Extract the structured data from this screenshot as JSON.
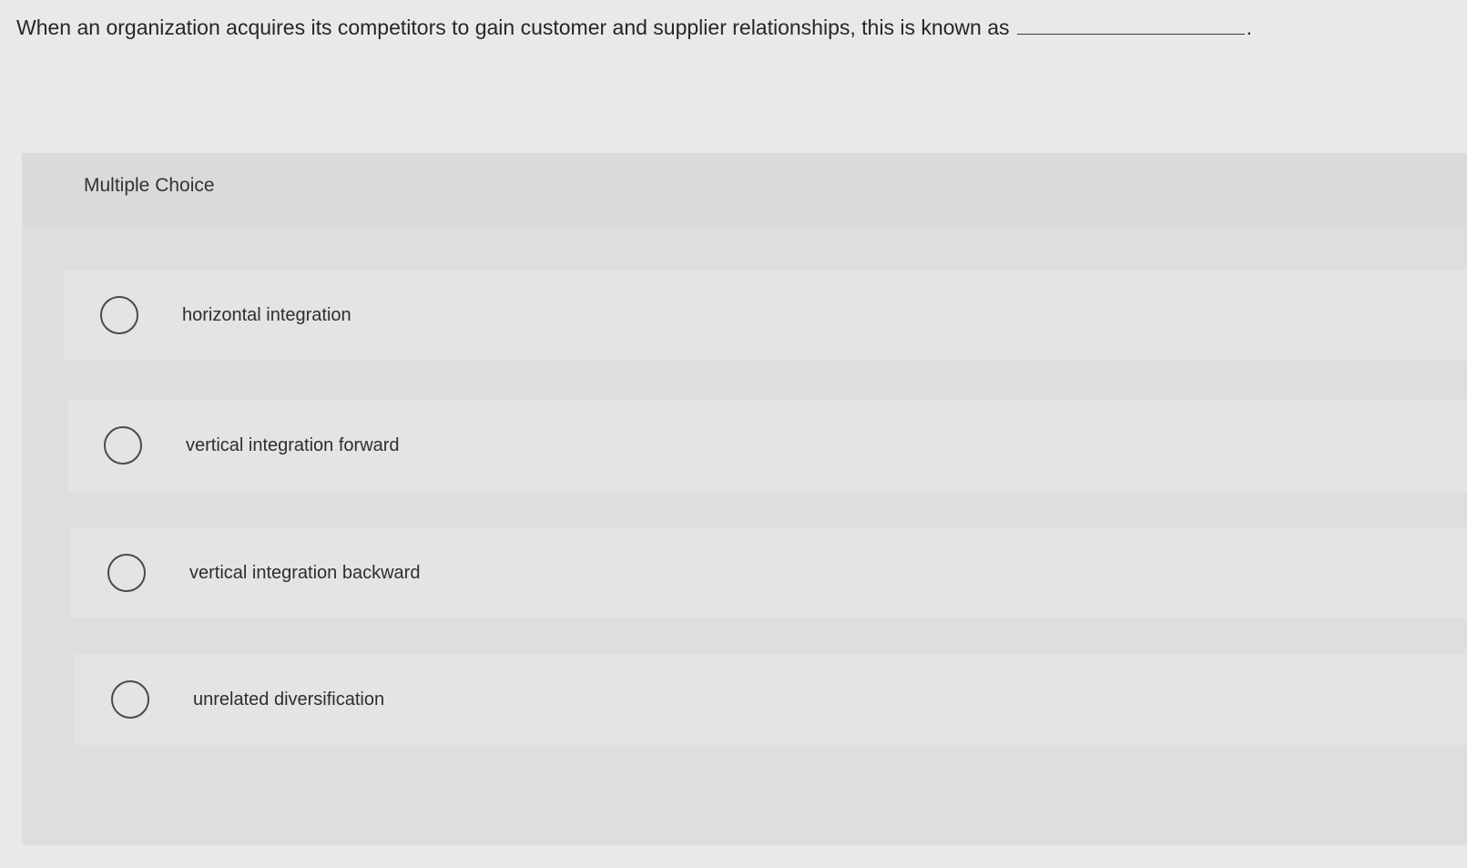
{
  "question": {
    "text": "When an organization acquires its competitors to gain customer and supplier relationships, this is known as",
    "end_punctuation": "."
  },
  "panel": {
    "title": "Multiple Choice",
    "options": [
      {
        "label": "horizontal integration",
        "selected": false
      },
      {
        "label": "vertical integration forward",
        "selected": false
      },
      {
        "label": "vertical integration backward",
        "selected": false
      },
      {
        "label": "unrelated diversification",
        "selected": false
      }
    ]
  }
}
